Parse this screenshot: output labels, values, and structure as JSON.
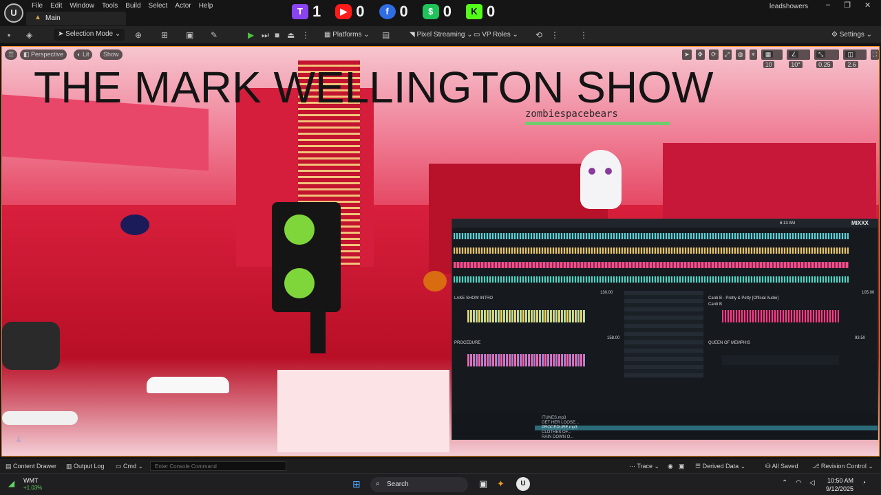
{
  "menu": [
    "File",
    "Edit",
    "Window",
    "Tools",
    "Build",
    "Select",
    "Actor",
    "Help"
  ],
  "tab": {
    "label": "Main"
  },
  "stream_counters": [
    {
      "platform": "twitch",
      "count": "1",
      "glyph": "T"
    },
    {
      "platform": "youtube",
      "count": "0",
      "glyph": "▶"
    },
    {
      "platform": "facebook",
      "count": "0",
      "glyph": "f"
    },
    {
      "platform": "cashapp",
      "count": "0",
      "glyph": "$"
    },
    {
      "platform": "kick",
      "count": "0",
      "glyph": "K"
    }
  ],
  "user": "leadshowers",
  "toolbar": {
    "selection_mode": "Selection Mode",
    "platforms": "Platforms",
    "pixel_streaming": "Pixel Streaming",
    "vp_roles": "VP Roles",
    "settings": "Settings"
  },
  "viewport": {
    "perspective": "Perspective",
    "lit": "Lit",
    "show": "Show",
    "grid_size": "10",
    "rotation_snap": "10°",
    "scale_snap": "0.25",
    "camera_speed": "2.6"
  },
  "overlay": {
    "title": "THE MARK WELLINGTON SHOW",
    "viewer_name": "zombiespacebears"
  },
  "dj": {
    "clock": "6:13 AM",
    "brand": "MIXXX",
    "deck1": {
      "title": "LAKE SHOW INTRO",
      "bpm": "130.00"
    },
    "deck2": {
      "title": "Cardi B - Pretty & Petty [Official Audio]",
      "artist": "Cardi B",
      "bpm": "105.00"
    },
    "deck3": {
      "title": "PROCEDURE",
      "bpm": "158.00"
    },
    "deck4": {
      "title": "QUEEN OF MEMPHIS",
      "bpm": "93.50"
    },
    "library_rows": [
      "ITUNES.mp3",
      "GET HER LOOSE...",
      "PROCEDURE.mp3",
      "CLOTHES OF...",
      "RAIN DOWN O..."
    ]
  },
  "statusbar": {
    "content_drawer": "Content Drawer",
    "output_log": "Output Log",
    "cmd": "Cmd",
    "console_placeholder": "Enter Console Command",
    "trace": "Trace",
    "derived_data": "Derived Data",
    "all_saved": "All Saved",
    "revision_control": "Revision Control"
  },
  "taskbar": {
    "stock_ticker": "WMT",
    "stock_change": "+1.03%",
    "search": "Search",
    "time": "10:50 AM",
    "date": "9/12/2025"
  },
  "colors": {
    "accent_orange": "#f08a1c",
    "play_green": "#4cc23b",
    "sky_pink": "#f18aa0",
    "scene_red": "#e23552"
  }
}
